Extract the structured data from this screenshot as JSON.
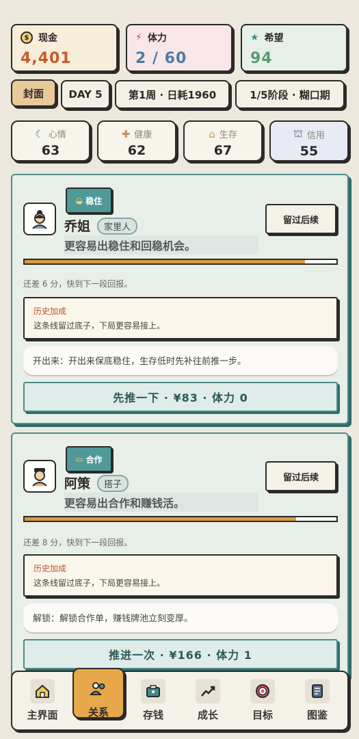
{
  "stats": {
    "cash": {
      "label": "现金",
      "value": "4,401",
      "color": "#c95a2a"
    },
    "stamina": {
      "label": "体力",
      "value": "2 / 60",
      "color": "#4f7ba6"
    },
    "hope": {
      "label": "希望",
      "value": "94",
      "color": "#5c9a72"
    }
  },
  "chips": {
    "cover": "封面",
    "day": "DAY 5",
    "week": "第1周 · 日耗1960",
    "stage": "1/5阶段 · 糊口期"
  },
  "meters": [
    {
      "label": "心情",
      "value": "63",
      "icon": "moon-icon"
    },
    {
      "label": "健康",
      "value": "62",
      "icon": "bandage-icon"
    },
    {
      "label": "生存",
      "value": "67",
      "icon": "house-icon"
    },
    {
      "label": "信用",
      "value": "55",
      "icon": "bank-icon"
    }
  ],
  "cards": [
    {
      "tag": "稳住",
      "name": "乔姐",
      "role": "家里人",
      "desc": "更容易出稳住和回稳机会。",
      "keep": "留过后续",
      "progress": 0.9,
      "hint": "还差 6 分，快到下一段回报。",
      "hist_title": "历史加成",
      "hist_desc": "这条线留过底子，下局更容易接上。",
      "note": "开出来：开出来保底稳住，生存低时先补往前推一步。",
      "action": "先推一下 · ¥83 · 体力 0"
    },
    {
      "tag": "合作",
      "name": "阿策",
      "role": "搭子",
      "desc": "更容易出合作和赚钱活。",
      "keep": "留过后续",
      "progress": 0.87,
      "hint": "还差 8 分，快到下一段回报。",
      "hist_title": "历史加成",
      "hist_desc": "这条线留过底子，下局更容易接上。",
      "note": "解锁：解锁合作单，赚钱牌池立刻变厚。",
      "action": "推进一次 · ¥166 · 体力 1"
    }
  ],
  "nav": [
    {
      "label": "主界面",
      "icon": "home-icon"
    },
    {
      "label": "关系",
      "icon": "people-icon"
    },
    {
      "label": "存钱",
      "icon": "wallet-icon"
    },
    {
      "label": "成长",
      "icon": "trend-icon"
    },
    {
      "label": "目标",
      "icon": "target-icon"
    },
    {
      "label": "图鉴",
      "icon": "book-icon"
    }
  ]
}
